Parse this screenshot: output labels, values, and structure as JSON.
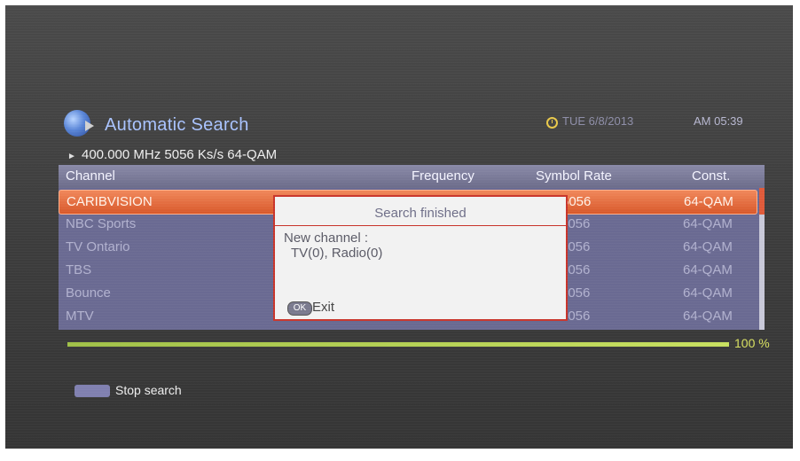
{
  "header": {
    "title": "Automatic Search",
    "date": "TUE 6/8/2013",
    "time": "AM 05:39",
    "transponder": "400.000 MHz  5056 Ks/s  64-QAM"
  },
  "table": {
    "columns": [
      "Channel",
      "Frequency",
      "Symbol Rate",
      "Const."
    ],
    "rows": [
      {
        "channel": "CARIBVISION",
        "frequency": "",
        "symbol_rate": "5056",
        "const": "64-QAM",
        "selected": true
      },
      {
        "channel": "NBC Sports",
        "frequency": "",
        "symbol_rate": "5056",
        "const": "64-QAM"
      },
      {
        "channel": "TV Ontario",
        "frequency": "",
        "symbol_rate": "5056",
        "const": "64-QAM"
      },
      {
        "channel": "TBS",
        "frequency": "",
        "symbol_rate": "5056",
        "const": "64-QAM"
      },
      {
        "channel": "Bounce",
        "frequency": "",
        "symbol_rate": "5056",
        "const": "64-QAM"
      },
      {
        "channel": "MTV",
        "frequency": "",
        "symbol_rate": "5056",
        "const": "64-QAM"
      }
    ]
  },
  "progress": {
    "value": 1.0,
    "label": "100 %"
  },
  "footer": {
    "stop_label": "Stop search"
  },
  "dialog": {
    "title": "Search finished",
    "line1": "New channel :",
    "line2": "TV(0), Radio(0)",
    "ok_key": "OK",
    "exit_label": "Exit"
  },
  "colors": {
    "accent_selection": "#e0683a",
    "dialog_border": "#c8342a",
    "progress": "#b8d458",
    "title": "#a9c3ff"
  },
  "icons": {
    "title_icon": "globe-satellite-icon",
    "clock": "clock-icon",
    "bullet": "triangle-bullet-icon"
  }
}
